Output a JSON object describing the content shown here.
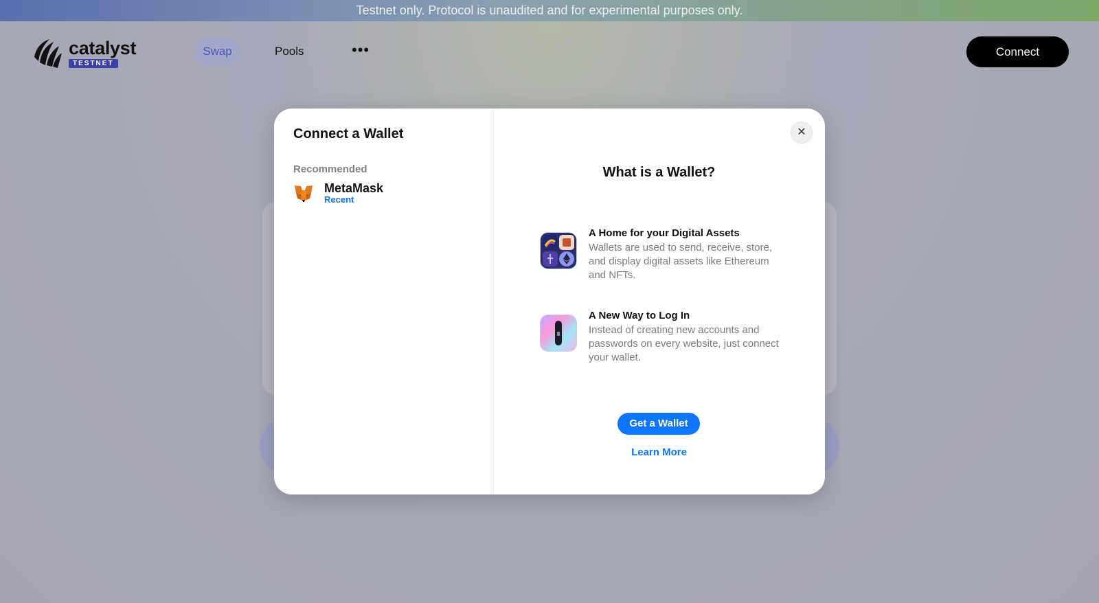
{
  "banner": {
    "text": "Testnet only. Protocol is unaudited and for experimental purposes only."
  },
  "header": {
    "logo_word": "catalyst",
    "logo_badge": "TESTNET",
    "nav": [
      {
        "label": "Swap",
        "active": true
      },
      {
        "label": "Pools",
        "active": false
      },
      {
        "label": "•••",
        "active": false
      }
    ],
    "connect_label": "Connect"
  },
  "modal": {
    "title": "Connect a Wallet",
    "section_label": "Recommended",
    "wallets": [
      {
        "name": "MetaMask",
        "tag": "Recent",
        "icon": "metamask-fox-icon"
      }
    ],
    "close_label": "✕",
    "info_title": "What is a Wallet?",
    "info_items": [
      {
        "title": "A Home for your Digital Assets",
        "body": "Wallets are used to send, receive, store, and display digital assets like Ethereum and NFTs.",
        "icon": "digital-assets-icon"
      },
      {
        "title": "A New Way to Log In",
        "body": "Instead of creating new accounts and passwords on every website, just connect your wallet.",
        "icon": "login-key-icon"
      }
    ],
    "get_wallet_label": "Get a Wallet",
    "learn_more_label": "Learn More"
  },
  "colors": {
    "accent": "#0e76fd",
    "badge": "#3d3fa8",
    "swap_text": "#4a55b8"
  }
}
